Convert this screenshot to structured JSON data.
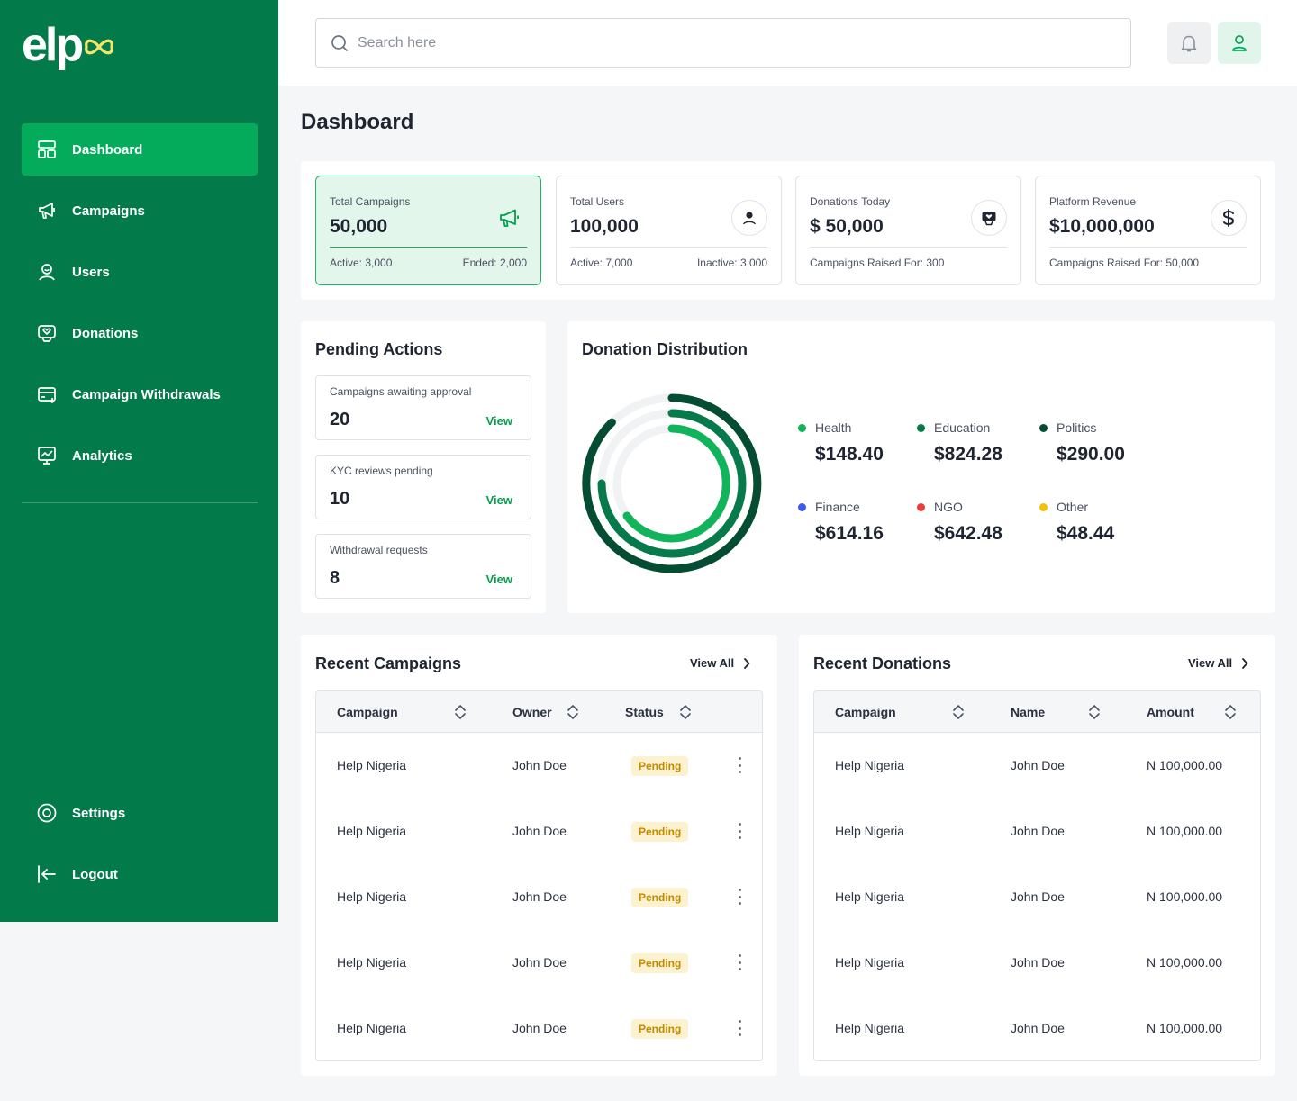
{
  "brand": {
    "logo_text": "elp"
  },
  "sidebar": {
    "items": [
      {
        "label": "Dashboard"
      },
      {
        "label": "Campaigns"
      },
      {
        "label": "Users"
      },
      {
        "label": "Donations"
      },
      {
        "label": "Campaign Withdrawals"
      },
      {
        "label": "Analytics"
      }
    ],
    "settings_label": "Settings",
    "logout_label": "Logout"
  },
  "search": {
    "placeholder": "Search here"
  },
  "page": {
    "title": "Dashboard"
  },
  "stats": [
    {
      "label": "Total Campaigns",
      "value": "50,000",
      "foot_left": "Active: 3,000",
      "foot_right": "Ended: 2,000",
      "icon": "megaphone-icon"
    },
    {
      "label": "Total Users",
      "value": "100,000",
      "foot_left": "Active: 7,000",
      "foot_right": "Inactive: 3,000",
      "icon": "users-icon"
    },
    {
      "label": "Donations Today",
      "value": "$ 50,000",
      "foot_left": "Campaigns Raised For: 300",
      "foot_right": "",
      "icon": "heart-hand-icon"
    },
    {
      "label": "Platform Revenue",
      "value": "$10,000,000",
      "foot_left": "Campaigns Raised For: 50,000",
      "foot_right": "",
      "icon": "dollar-icon"
    }
  ],
  "pending": {
    "title": "Pending Actions",
    "items": [
      {
        "label": "Campaigns awaiting approval",
        "value": "20",
        "action": "View"
      },
      {
        "label": "KYC reviews pending",
        "value": "10",
        "action": "View"
      },
      {
        "label": "Withdrawal requests",
        "value": "8",
        "action": "View"
      }
    ]
  },
  "distribution": {
    "title": "Donation Distribution",
    "items": [
      {
        "name": "Health",
        "value": "$148.40",
        "color": "#12B45B"
      },
      {
        "name": "Education",
        "value": "$824.28",
        "color": "#067A4B"
      },
      {
        "name": "Politics",
        "value": "$290.00",
        "color": "#044D32"
      },
      {
        "name": "Finance",
        "value": "$614.16",
        "color": "#3B5BEA"
      },
      {
        "name": "NGO",
        "value": "$642.48",
        "color": "#EE3B3B"
      },
      {
        "name": "Other",
        "value": "$48.44",
        "color": "#F2C10A"
      }
    ]
  },
  "recent_campaigns": {
    "title": "Recent Campaigns",
    "view_all": "View All",
    "columns": [
      "Campaign",
      "Owner",
      "Status"
    ],
    "rows": [
      {
        "campaign": "Help Nigeria",
        "owner": "John Doe",
        "status": "Pending"
      },
      {
        "campaign": "Help Nigeria",
        "owner": "John Doe",
        "status": "Pending"
      },
      {
        "campaign": "Help Nigeria",
        "owner": "John Doe",
        "status": "Pending"
      },
      {
        "campaign": "Help Nigeria",
        "owner": "John Doe",
        "status": "Pending"
      },
      {
        "campaign": "Help Nigeria",
        "owner": "John Doe",
        "status": "Pending"
      }
    ]
  },
  "recent_donations": {
    "title": "Recent Donations",
    "view_all": "View All",
    "columns": [
      "Campaign",
      "Name",
      "Amount"
    ],
    "rows": [
      {
        "campaign": "Help Nigeria",
        "name": "John Doe",
        "amount": "N 100,000.00"
      },
      {
        "campaign": "Help Nigeria",
        "name": "John Doe",
        "amount": "N 100,000.00"
      },
      {
        "campaign": "Help Nigeria",
        "name": "John Doe",
        "amount": "N 100,000.00"
      },
      {
        "campaign": "Help Nigeria",
        "name": "John Doe",
        "amount": "N 100,000.00"
      },
      {
        "campaign": "Help Nigeria",
        "name": "John Doe",
        "amount": "N 100,000.00"
      }
    ]
  },
  "colors": {
    "brand_green": "#037A4A",
    "active_green": "#04AB5A",
    "pending_bg": "#FDF2D0",
    "pending_text": "#C28A00"
  }
}
